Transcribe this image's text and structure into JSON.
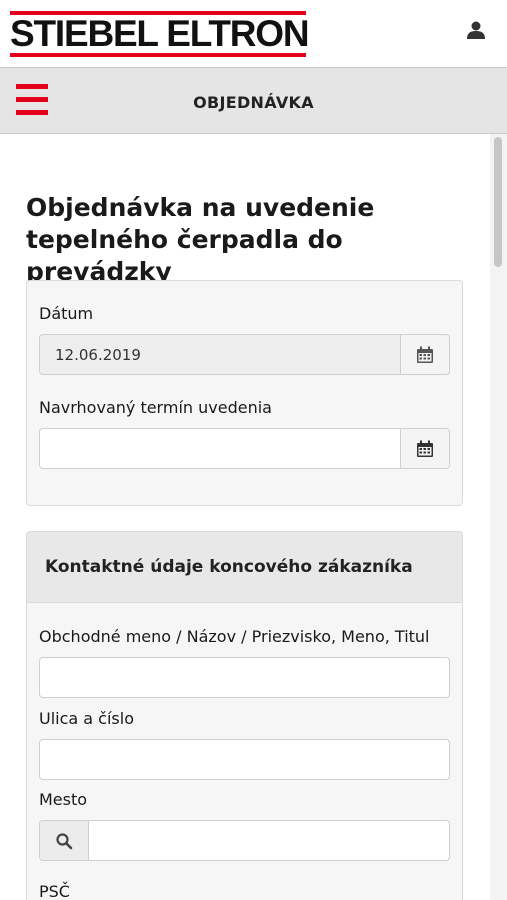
{
  "header": {
    "logo_text": "STIEBEL ELTRON",
    "user_icon": "user-icon"
  },
  "navbar": {
    "menu_icon": "hamburger-menu-icon",
    "title": "OBJEDNÁVKA"
  },
  "page": {
    "title": "Objednávka na uvedenie tepelného čerpadla do prevádzky"
  },
  "dates_section": {
    "date_label": "Dátum",
    "date_value": "12.06.2019",
    "proposed_label": "Navrhovaný termín uvedenia",
    "proposed_value": "",
    "calendar_icon": "calendar-icon"
  },
  "customer_section": {
    "title": "Kontaktné údaje koncového zákazníka",
    "name_label": "Obchodné meno / Názov / Priezvisko, Meno, Titul",
    "name_value": "",
    "street_label": "Ulica a číslo",
    "street_value": "",
    "city_label": "Mesto",
    "city_value": "",
    "search_icon": "search-icon",
    "zip_label": "PSČ"
  },
  "colors": {
    "brand_red": "#e2001a",
    "navbar_bg": "#e5e5e5",
    "card_bg": "#f6f6f6"
  }
}
